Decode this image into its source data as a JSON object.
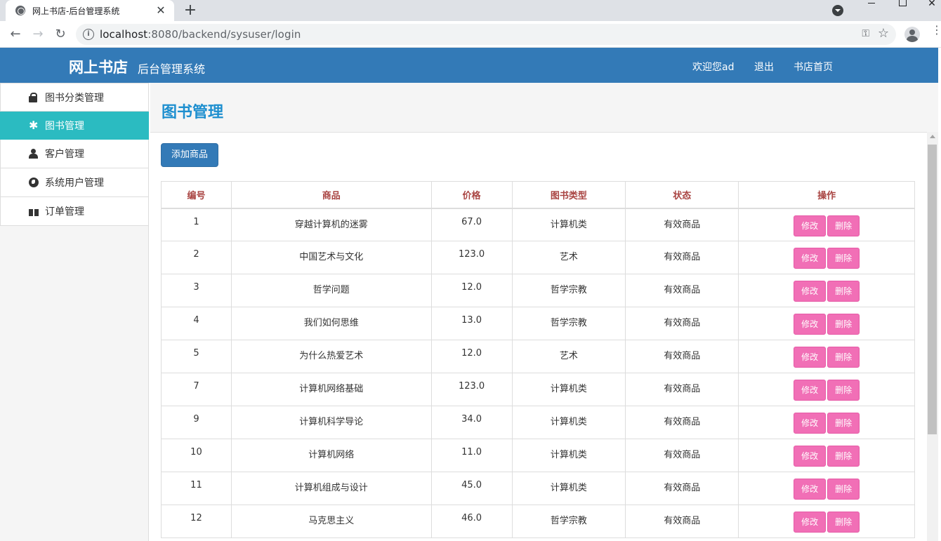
{
  "browser": {
    "tab_title": "网上书店-后台管理系统",
    "tab_close": "✕",
    "new_tab": "+",
    "url_host": "localhost",
    "url_rest": ":8080/backend/sysuser/login",
    "back": "←",
    "forward": "→",
    "reload": "↻",
    "win_close": "✕",
    "info": "i",
    "key": "⚿",
    "star": "☆",
    "menu": "⋮"
  },
  "header": {
    "brand": "网上书店",
    "subtitle": "后台管理系统",
    "welcome": "欢迎您ad",
    "logout": "退出",
    "home": "书店首页"
  },
  "sidebar": {
    "items": [
      {
        "label": "图书分类管理",
        "icon": "lock-icon"
      },
      {
        "label": "图书管理",
        "icon": "asterisk-icon"
      },
      {
        "label": "客户管理",
        "icon": "user-icon"
      },
      {
        "label": "系统用户管理",
        "icon": "globe-icon"
      },
      {
        "label": "订单管理",
        "icon": "gift-icon"
      }
    ],
    "active_index": 1,
    "asterisk_glyph": "✱"
  },
  "main": {
    "title": "图书管理",
    "add_button": "添加商品",
    "columns": [
      "编号",
      "商品",
      "价格",
      "图书类型",
      "状态",
      "操作"
    ],
    "edit_label": "修改",
    "delete_label": "删除",
    "rows": [
      [
        "1",
        "穿越计算机的迷雾",
        "67.0",
        "计算机类",
        "有效商品"
      ],
      [
        "2",
        "中国艺术与文化",
        "123.0",
        "艺术",
        "有效商品"
      ],
      [
        "3",
        "哲学问题",
        "12.0",
        "哲学宗教",
        "有效商品"
      ],
      [
        "4",
        "我们如何思维",
        "13.0",
        "哲学宗教",
        "有效商品"
      ],
      [
        "5",
        "为什么热爱艺术",
        "12.0",
        "艺术",
        "有效商品"
      ],
      [
        "7",
        "计算机网络基础",
        "123.0",
        "计算机类",
        "有效商品"
      ],
      [
        "9",
        "计算机科学导论",
        "34.0",
        "计算机类",
        "有效商品"
      ],
      [
        "10",
        "计算机网络",
        "11.0",
        "计算机类",
        "有效商品"
      ],
      [
        "11",
        "计算机组成与设计",
        "45.0",
        "计算机类",
        "有效商品"
      ],
      [
        "12",
        "马克思主义",
        "46.0",
        "哲学宗教",
        "有效商品"
      ]
    ]
  },
  "colors": {
    "header_bg": "#337ab7",
    "sidebar_active": "#2bbbc1",
    "title_blue": "#1e8fcf",
    "column_header": "#a94442",
    "action_button": "#f16fb6"
  }
}
